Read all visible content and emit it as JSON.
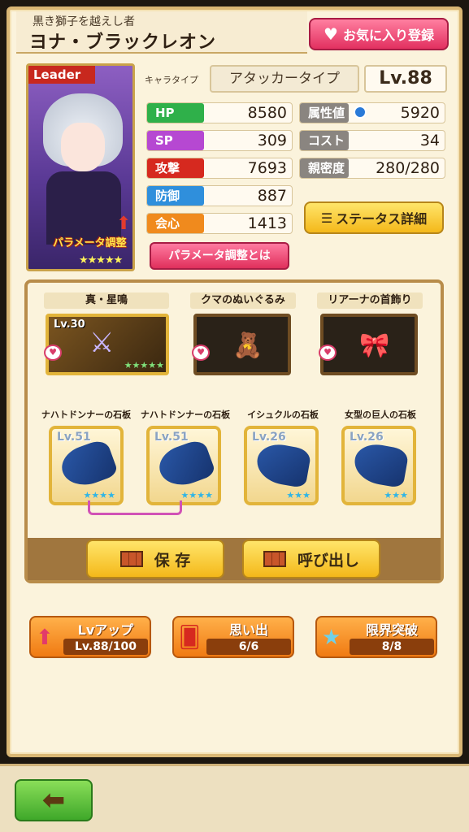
{
  "header": {
    "epithet": "黒き獅子を越えし者",
    "name": "ヨナ・ブラックレオン",
    "favorite_label": "お気に入り登録"
  },
  "portrait": {
    "leader_tag": "Leader",
    "param_label": "パラメータ調整",
    "stars": "★★★★★"
  },
  "profile": {
    "type_label": "キャラタイプ",
    "type_value": "アタッカータイプ",
    "level": "Lv.88"
  },
  "stats": {
    "hp_label": "HP",
    "hp": "8580",
    "sp_label": "SP",
    "sp": "309",
    "atk_label": "攻撃",
    "atk": "7693",
    "def_label": "防御",
    "def": "887",
    "crit_label": "会心",
    "crit": "1413",
    "attr_label": "属性値",
    "attr": "5920",
    "cost_label": "コスト",
    "cost": "34",
    "intimacy_label": "親密度",
    "intimacy": "280/280"
  },
  "buttons": {
    "status_detail": "ステータス詳細",
    "param_about": "パラメータ調整とは",
    "save": "保 存",
    "load": "呼び出し"
  },
  "equipment": [
    {
      "label": "真・星鳴",
      "level": "Lv.30"
    },
    {
      "label": "クマのぬいぐるみ",
      "level": ""
    },
    {
      "label": "リアーナの首飾り",
      "level": ""
    }
  ],
  "slates": [
    {
      "label": "ナハトドンナーの石板",
      "level": "Lv.51",
      "stars": "★★★★"
    },
    {
      "label": "ナハトドンナーの石板",
      "level": "Lv.51",
      "stars": "★★★★"
    },
    {
      "label": "イシュクルの石板",
      "level": "Lv.26",
      "stars": "★★★"
    },
    {
      "label": "女型の巨人の石板",
      "level": "Lv.26",
      "stars": "★★★"
    }
  ],
  "actions": {
    "lvup_label": "Lvアップ",
    "lvup_value": "Lv.88/100",
    "memory_label": "思い出",
    "memory_value": "6/6",
    "limit_label": "限界突破",
    "limit_value": "8/8"
  }
}
